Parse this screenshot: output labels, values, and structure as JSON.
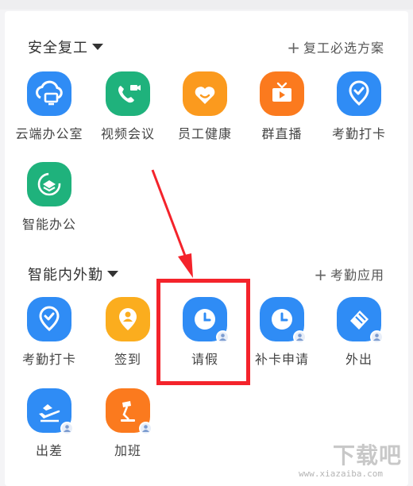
{
  "section1": {
    "title": "安全复工",
    "action": "复工必选方案",
    "apps": [
      {
        "label": "云端办公室",
        "icon": "cloud-office-icon",
        "color": "#2f8cf5"
      },
      {
        "label": "视频会议",
        "icon": "video-call-icon",
        "color": "#1fb27c"
      },
      {
        "label": "员工健康",
        "icon": "heart-icon",
        "color": "#fb9a1e"
      },
      {
        "label": "群直播",
        "icon": "live-tv-icon",
        "color": "#fb7a1e"
      },
      {
        "label": "考勤打卡",
        "icon": "location-check-icon",
        "color": "#2f8cf5"
      },
      {
        "label": "智能办公",
        "icon": "layers-icon",
        "color": "#1fb27c"
      }
    ]
  },
  "section2": {
    "title": "智能内外勤",
    "action": "考勤应用",
    "apps": [
      {
        "label": "考勤打卡",
        "icon": "location-check-icon",
        "color": "#2f8cf5"
      },
      {
        "label": "签到",
        "icon": "location-person-icon",
        "color": "#fbad1e"
      },
      {
        "label": "请假",
        "icon": "clock-icon",
        "color": "#2f8cf5"
      },
      {
        "label": "补卡申请",
        "icon": "clock-icon",
        "color": "#2f8cf5"
      },
      {
        "label": "外出",
        "icon": "outing-icon",
        "color": "#2f8cf5"
      },
      {
        "label": "出差",
        "icon": "airplane-icon",
        "color": "#2f8cf5"
      },
      {
        "label": "加班",
        "icon": "desk-lamp-icon",
        "color": "#fb7a1e"
      }
    ]
  },
  "watermark": {
    "logo": "下载吧",
    "url": "www.xiazaiba.com"
  },
  "annotation": {
    "highlight_color": "#f4232b"
  }
}
